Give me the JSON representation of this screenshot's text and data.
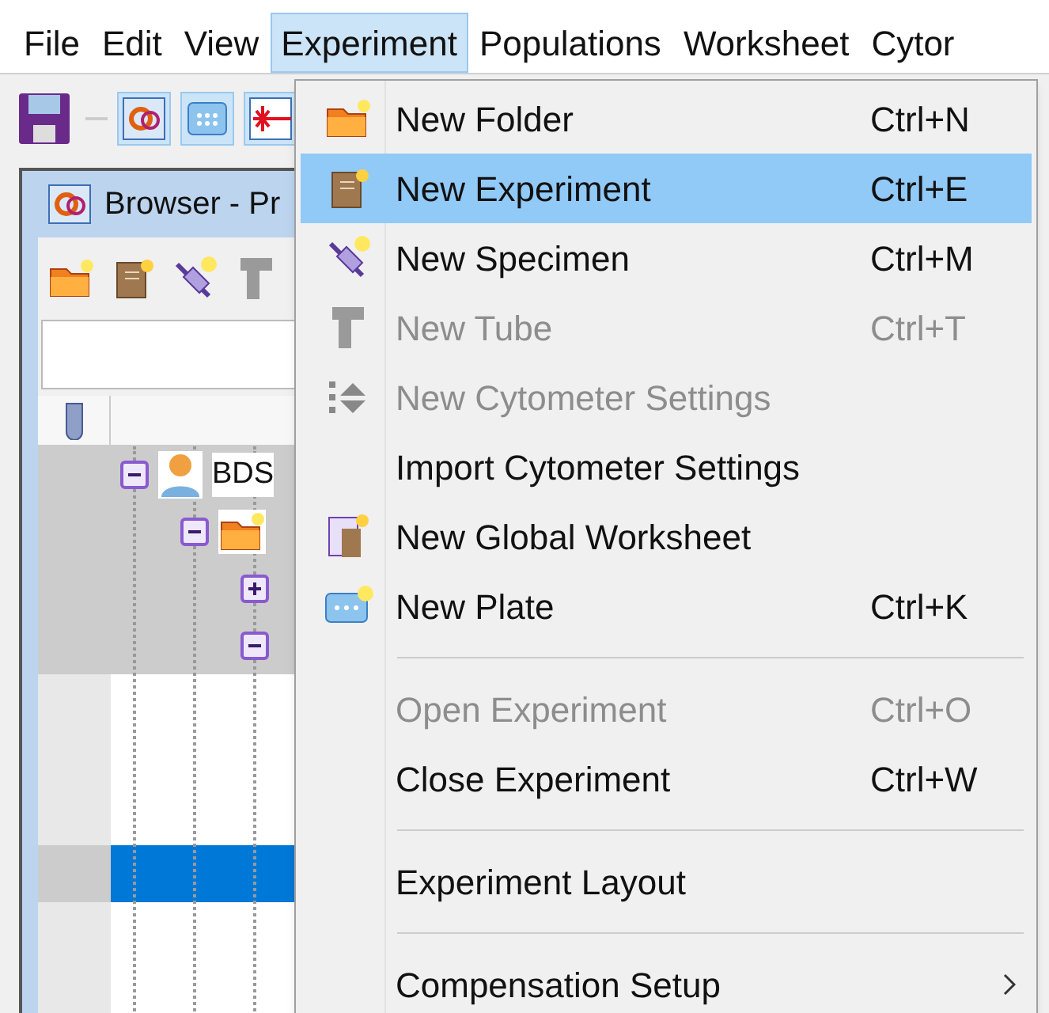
{
  "menu_bar": [
    {
      "label": "File",
      "selected": false
    },
    {
      "label": "Edit",
      "selected": false
    },
    {
      "label": "View",
      "selected": false
    },
    {
      "label": "Experiment",
      "selected": true
    },
    {
      "label": "Populations",
      "selected": false
    },
    {
      "label": "Worksheet",
      "selected": false
    },
    {
      "label": "Cytor",
      "selected": false
    }
  ],
  "toolbar": [
    {
      "pressed": false
    },
    {
      "pressed": true
    },
    {
      "pressed": true
    },
    {
      "pressed": true
    }
  ],
  "browser": {
    "title": "Browser - Pr",
    "tree": [
      {
        "label": "BDS",
        "expanded": true,
        "children": [
          {
            "expanded": true,
            "children": [
              {
                "expanded": false
              },
              {
                "expanded": true
              }
            ]
          }
        ]
      }
    ],
    "empty_rows": [
      {
        "selected": false
      },
      {
        "selected": false
      },
      {
        "selected": false
      },
      {
        "selected": true
      },
      {
        "selected": false
      },
      {
        "selected": false
      }
    ]
  },
  "experiment_menu": [
    {
      "kind": "item",
      "label": "New Folder",
      "shortcut": "Ctrl+N",
      "disabled": false,
      "selected": false
    },
    {
      "kind": "item",
      "label": "New Experiment",
      "shortcut": "Ctrl+E",
      "disabled": false,
      "selected": true
    },
    {
      "kind": "item",
      "label": "New Specimen",
      "shortcut": "Ctrl+M",
      "disabled": false,
      "selected": false
    },
    {
      "kind": "item",
      "label": "New Tube",
      "shortcut": "Ctrl+T",
      "disabled": true,
      "selected": false
    },
    {
      "kind": "item",
      "label": "New Cytometer Settings",
      "disabled": true,
      "selected": false
    },
    {
      "kind": "item",
      "label": "Import Cytometer Settings",
      "disabled": false,
      "selected": false
    },
    {
      "kind": "item",
      "label": "New Global Worksheet",
      "disabled": false,
      "selected": false
    },
    {
      "kind": "item",
      "label": "New Plate",
      "shortcut": "Ctrl+K",
      "disabled": false,
      "selected": false
    },
    {
      "kind": "separator"
    },
    {
      "kind": "item",
      "label": "Open Experiment",
      "shortcut": "Ctrl+O",
      "disabled": true,
      "selected": false
    },
    {
      "kind": "item",
      "label": "Close Experiment",
      "shortcut": "Ctrl+W",
      "disabled": false,
      "selected": false
    },
    {
      "kind": "separator"
    },
    {
      "kind": "item",
      "label": "Experiment Layout",
      "disabled": false,
      "selected": false
    },
    {
      "kind": "separator"
    },
    {
      "kind": "item",
      "label": "Compensation Setup",
      "disabled": false,
      "selected": false,
      "submenu": true
    }
  ]
}
